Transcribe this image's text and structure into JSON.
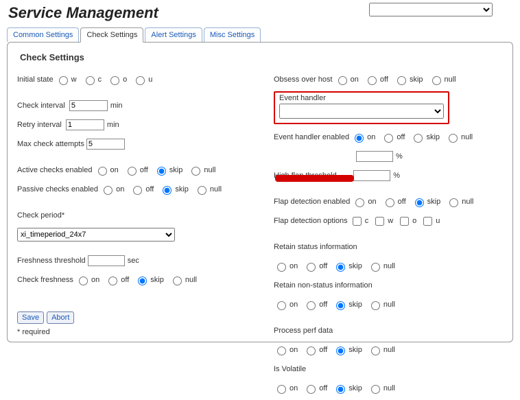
{
  "title": "Service Management",
  "top_select_value": "",
  "tabs": {
    "common": "Common Settings",
    "check": "Check Settings",
    "alert": "Alert Settings",
    "misc": "Misc Settings"
  },
  "section_title": "Check Settings",
  "labels": {
    "initial_state": "Initial state",
    "check_interval": "Check interval",
    "retry_interval": "Retry interval",
    "max_check_attempts": "Max check attempts",
    "active_checks_enabled": "Active checks enabled",
    "passive_checks_enabled": "Passive checks enabled",
    "check_period": "Check period*",
    "freshness_threshold": "Freshness threshold",
    "check_freshness": "Check freshness",
    "obsess_over_host": "Obsess over host",
    "event_handler": "Event handler",
    "event_handler_enabled": "Event handler enabled",
    "high_flap_threshold": "High flap threshold",
    "flap_detection_enabled": "Flap detection enabled",
    "flap_detection_options": "Flap detection options",
    "retain_status_info": "Retain status information",
    "retain_nonstatus_info": "Retain non-status information",
    "process_perf_data": "Process perf data",
    "is_volatile": "Is Volatile",
    "min": "min",
    "sec": "sec",
    "percent": "%"
  },
  "values": {
    "check_interval": "5",
    "retry_interval": "1",
    "max_check_attempts": "5",
    "check_period": "xi_timeperiod_24x7",
    "freshness_threshold": "",
    "high_flap_threshold": "",
    "event_handler_selected": ""
  },
  "radio_opts": {
    "wc_ou": {
      "w": "w",
      "c": "c",
      "o": "o",
      "u": "u"
    },
    "on": "on",
    "off": "off",
    "skip": "skip",
    "null": "null"
  },
  "check_opts": {
    "c": "c",
    "w": "w",
    "o": "o",
    "u": "u"
  },
  "buttons": {
    "save": "Save",
    "abort": "Abort"
  },
  "required": "* required"
}
